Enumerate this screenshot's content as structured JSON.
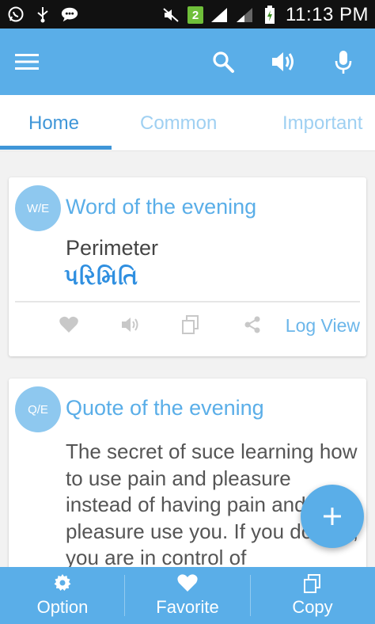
{
  "status_bar": {
    "time": "11:13 PM",
    "sim_badge": "2",
    "left_icons": [
      "whatsapp-icon",
      "usb-icon",
      "chat-icon"
    ],
    "right_icons": [
      "mute-icon",
      "signal-icon",
      "signal-icon",
      "battery-charging-icon"
    ]
  },
  "app_bar": {
    "actions": [
      "menu-icon",
      "search-icon",
      "volume-icon",
      "mic-icon"
    ],
    "color": "#5aaee8"
  },
  "tabs": [
    {
      "label": "Home",
      "active": true
    },
    {
      "label": "Common",
      "active": false
    },
    {
      "label": "Important",
      "active": false
    }
  ],
  "word_card": {
    "badge": "W/E",
    "title": "Word of the evening",
    "word": "Perimeter",
    "translation": "પરિમિતિ",
    "actions": [
      "heart-icon",
      "volume-icon",
      "copy-icon",
      "share-icon"
    ],
    "log_view": "Log View"
  },
  "quote_card": {
    "badge": "Q/E",
    "title": "Quote of the evening",
    "text": "The secret of suce learning how to use pain and pleasure instead of having pain and pleasure use you. If you do that, you are in control of"
  },
  "fab": {
    "icon": "plus-icon"
  },
  "bottom_bar": [
    {
      "label": "Option",
      "icon": "gear-icon"
    },
    {
      "label": "Favorite",
      "icon": "heart-icon"
    },
    {
      "label": "Copy",
      "icon": "copy-icon"
    }
  ]
}
